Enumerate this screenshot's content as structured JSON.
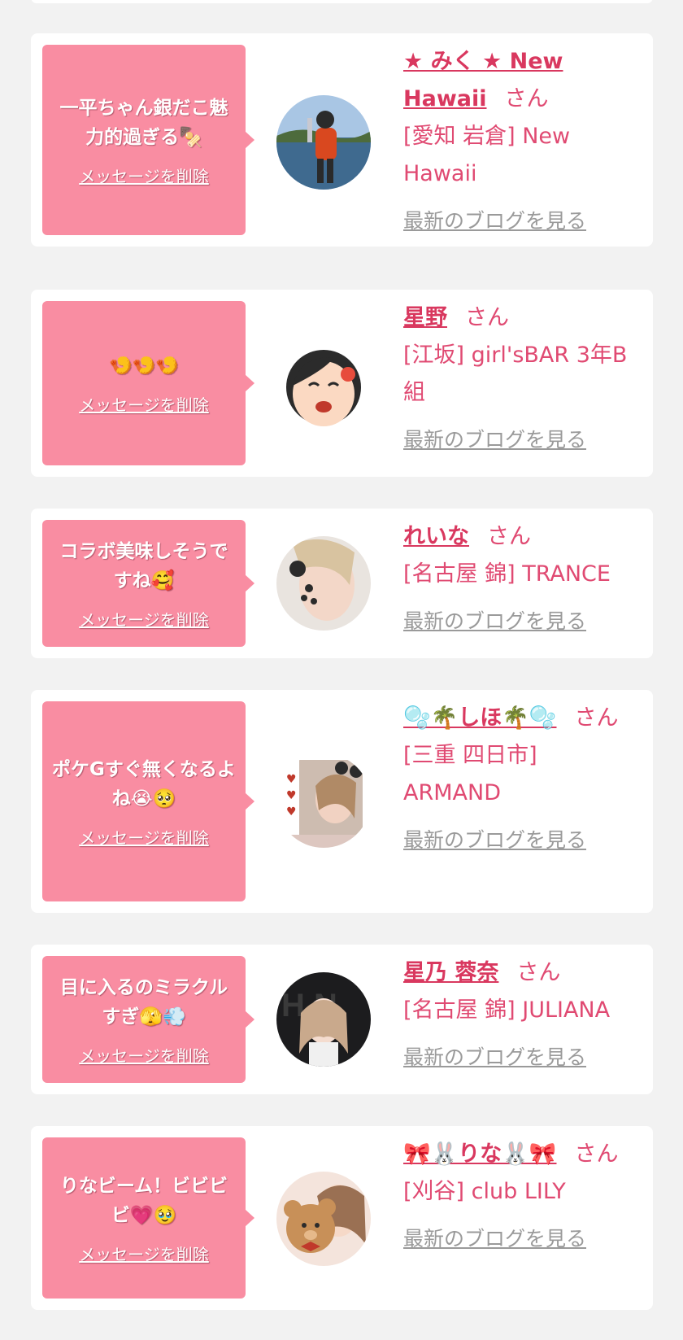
{
  "colors": {
    "background": "#f2f2f2",
    "card": "#ffffff",
    "bubble": "#f98da2",
    "name": "#d9385f",
    "text": "#e04a72",
    "blog_link": "#9a9a9a"
  },
  "delete_label": "メッセージを削除",
  "blog_label": "最新のブログを見る",
  "honorific": "さん",
  "messages": [
    {
      "message": "一平ちゃん銀だこ魅力的過ぎる🍢",
      "name": "★ みく ★ New Hawaii",
      "place": "[愛知 岩倉] New Hawaii",
      "avatar_icon": "avatar-photo-fishing"
    },
    {
      "message": "🍤🍤🍤",
      "name": "星野",
      "place": "[江坂] girl'sBAR 3年B組",
      "avatar_icon": "avatar-illustration-girl"
    },
    {
      "message": "コラボ美味しそうですね🥰",
      "name": "れいな",
      "place": "[名古屋 錦] TRANCE",
      "avatar_icon": "avatar-photo-selfie"
    },
    {
      "message": "ポケGすぐ無くなるよね😭🥺",
      "name": "🫧🌴しほ🌴🫧",
      "place": "[三重 四日市] ARMAND",
      "avatar_icon": "avatar-photo-hearts"
    },
    {
      "message": "目に入るのミラクルすぎ🫣💨",
      "name": "星乃 蓉奈",
      "place": "[名古屋 錦] JULIANA",
      "avatar_icon": "avatar-photo-dark"
    },
    {
      "message": "りなビーム！ビビビビ💗🥹",
      "name": "🎀🐰りな🐰🎀",
      "place": "[刈谷] club LILY",
      "avatar_icon": "avatar-photo-bear"
    }
  ]
}
